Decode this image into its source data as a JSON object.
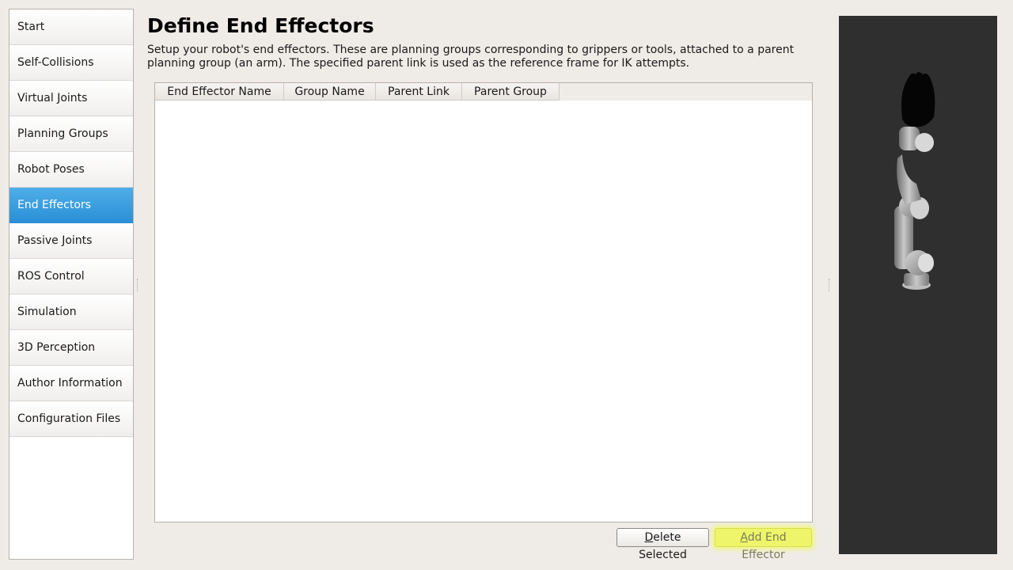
{
  "sidebar": {
    "items": [
      {
        "label": "Start"
      },
      {
        "label": "Self-Collisions"
      },
      {
        "label": "Virtual Joints"
      },
      {
        "label": "Planning Groups"
      },
      {
        "label": "Robot Poses"
      },
      {
        "label": "End Effectors"
      },
      {
        "label": "Passive Joints"
      },
      {
        "label": "ROS Control"
      },
      {
        "label": "Simulation"
      },
      {
        "label": "3D Perception"
      },
      {
        "label": "Author Information"
      },
      {
        "label": "Configuration Files"
      }
    ],
    "active_label": "End Effectors"
  },
  "page": {
    "title": "Define End Effectors",
    "description": "Setup your robot's end effectors. These are planning groups corresponding to grippers or tools, attached to a parent planning group (an arm). The specified parent link is used as the reference frame for IK attempts."
  },
  "table": {
    "columns": [
      "End Effector Name",
      "Group Name",
      "Parent Link",
      "Parent Group"
    ],
    "rows": []
  },
  "buttons": {
    "delete_mnemonic": "D",
    "delete_rest": "elete Selected",
    "add_mnemonic": "A",
    "add_rest": "dd End Effector"
  },
  "colors": {
    "active_nav": "#2a8fd6",
    "highlight": "#eef56a",
    "viewport_bg": "#2f2f2f"
  }
}
